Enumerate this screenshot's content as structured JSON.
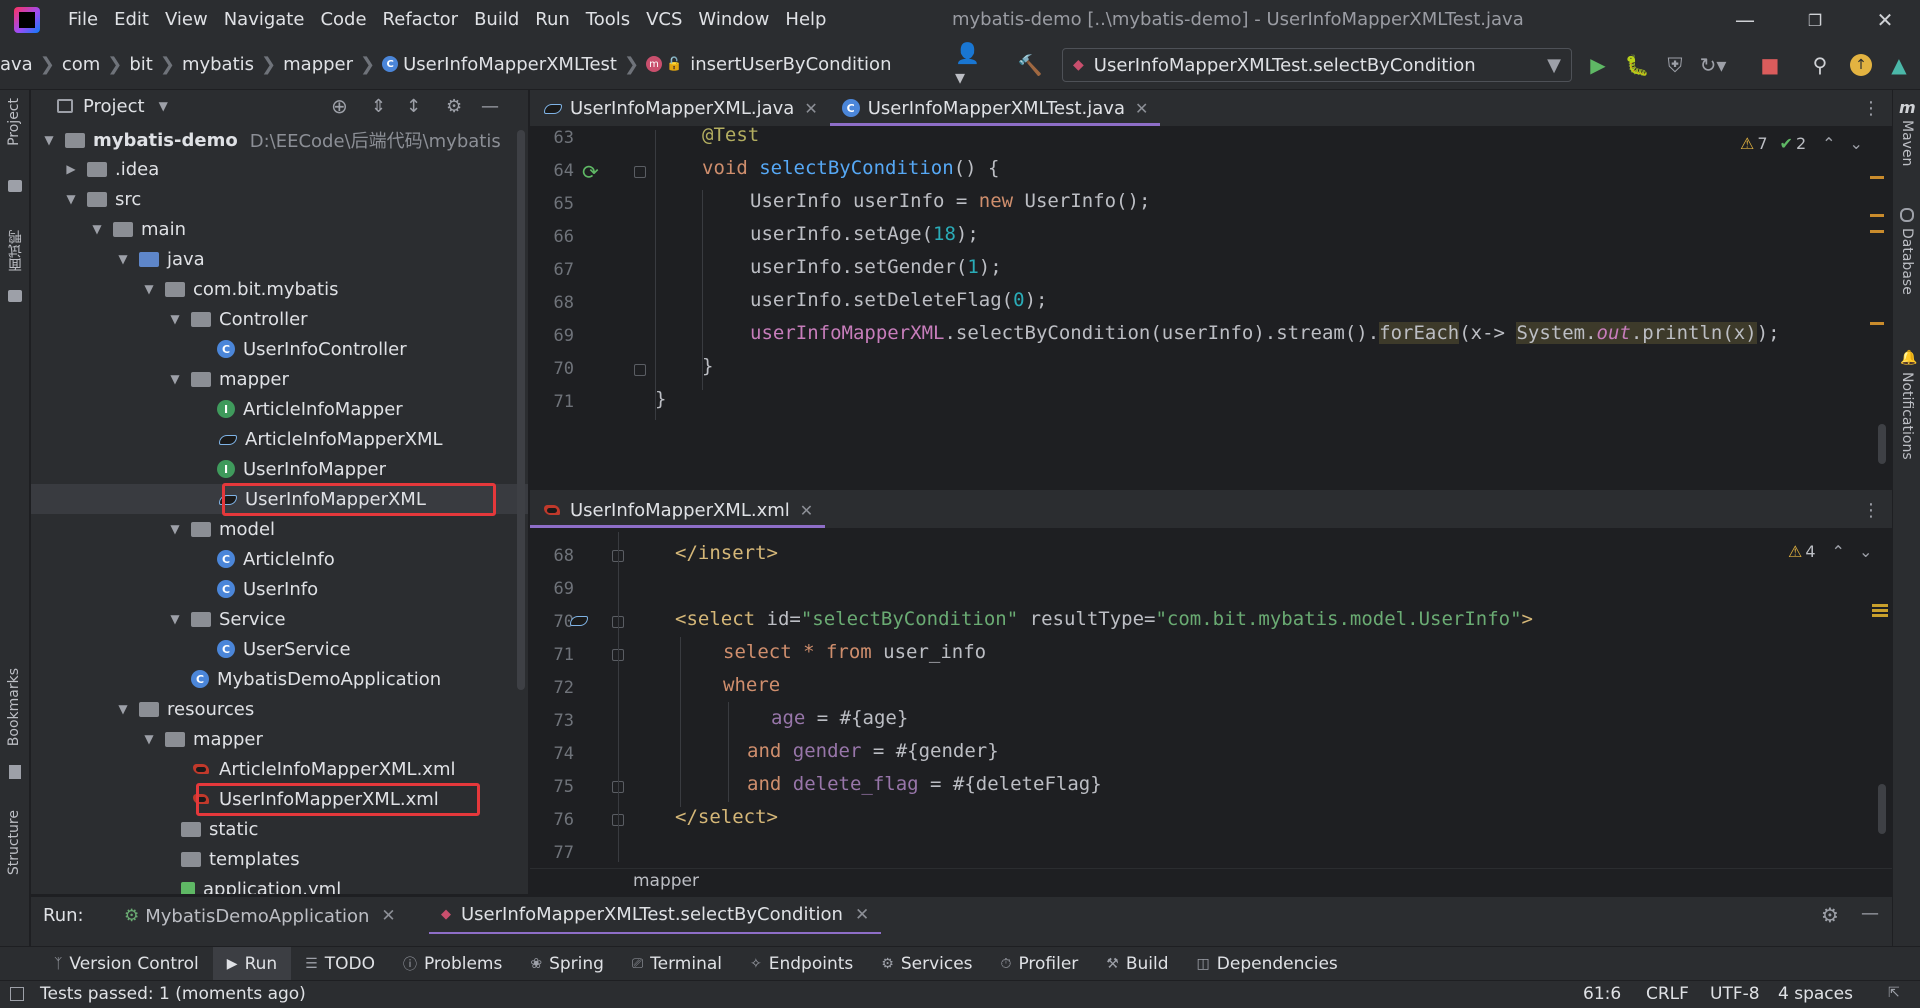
{
  "window": {
    "menus": [
      "File",
      "Edit",
      "View",
      "Navigate",
      "Code",
      "Refactor",
      "Build",
      "Run",
      "Tools",
      "VCS",
      "Window",
      "Help"
    ],
    "title": "mybatis-demo [..\\mybatis-demo] - UserInfoMapperXMLTest.java"
  },
  "breadcrumbs": [
    "ava",
    "com",
    "bit",
    "mybatis",
    "mapper",
    "UserInfoMapperXMLTest",
    "insertUserByCondition"
  ],
  "run_config": "UserInfoMapperXMLTest.selectByCondition",
  "left_stripe": {
    "project": "Project",
    "mianshi": "面试鸭",
    "bookmarks": "Bookmarks",
    "structure": "Structure"
  },
  "right_stripe": {
    "maven": "Maven",
    "database": "Database",
    "notifications": "Notifications"
  },
  "project_panel": {
    "title": "Project",
    "tree": [
      {
        "label": "mybatis-demo",
        "extra": "D:\\EECode\\后端代码\\mybatis",
        "kind": "module"
      },
      {
        "label": ".idea",
        "kind": "folder"
      },
      {
        "label": "src",
        "kind": "folder"
      },
      {
        "label": "main",
        "kind": "folder"
      },
      {
        "label": "java",
        "kind": "folder-blue"
      },
      {
        "label": "com.bit.mybatis",
        "kind": "package"
      },
      {
        "label": "Controller",
        "kind": "package"
      },
      {
        "label": "UserInfoController",
        "kind": "class"
      },
      {
        "label": "mapper",
        "kind": "package"
      },
      {
        "label": "ArticleInfoMapper",
        "kind": "interface"
      },
      {
        "label": "ArticleInfoMapperXML",
        "kind": "mybatis"
      },
      {
        "label": "UserInfoMapper",
        "kind": "interface"
      },
      {
        "label": "UserInfoMapperXML",
        "kind": "mybatis"
      },
      {
        "label": "model",
        "kind": "package"
      },
      {
        "label": "ArticleInfo",
        "kind": "class"
      },
      {
        "label": "UserInfo",
        "kind": "class"
      },
      {
        "label": "Service",
        "kind": "package"
      },
      {
        "label": "UserService",
        "kind": "class"
      },
      {
        "label": "MybatisDemoApplication",
        "kind": "springclass"
      },
      {
        "label": "resources",
        "kind": "folder-res"
      },
      {
        "label": "mapper",
        "kind": "folder"
      },
      {
        "label": "ArticleInfoMapperXML.xml",
        "kind": "xml"
      },
      {
        "label": "UserInfoMapperXML.xml",
        "kind": "xml"
      },
      {
        "label": "static",
        "kind": "folder"
      },
      {
        "label": "templates",
        "kind": "folder"
      },
      {
        "label": "application.yml",
        "kind": "yml"
      }
    ]
  },
  "editor_top": {
    "tabs": [
      {
        "label": "UserInfoMapperXML.java",
        "active": false
      },
      {
        "label": "UserInfoMapperXMLTest.java",
        "active": true
      }
    ],
    "warnings": "7",
    "checks": "2",
    "line_numbers": [
      "63",
      "64",
      "65",
      "66",
      "67",
      "68",
      "69",
      "70",
      "71"
    ],
    "code": {
      "l63": "@Test",
      "l64_kw": "void",
      "l64_fn": "selectByCondition",
      "l64_rest": "() {",
      "l65_a": "UserInfo userInfo = ",
      "l65_kw": "new",
      "l65_b": " UserInfo();",
      "l66_a": "userInfo.setAge(",
      "l66_n": "18",
      "l66_b": ");",
      "l67_a": "userInfo.setGender(",
      "l67_n": "1",
      "l67_b": ");",
      "l68_a": "userInfo.setDeleteFlag(",
      "l68_n": "0",
      "l68_b": ");",
      "l69_fld": "userInfoMapperXML",
      "l69_a": ".selectByCondition(userInfo).stream().",
      "l69_fe": "forEach",
      "l69_b": "(x-> ",
      "l69_sys": "System.",
      "l69_out": "out",
      "l69_c": ".println(x)",
      "l69_d": ");",
      "l70": "}",
      "l71": "}"
    }
  },
  "editor_bottom": {
    "tabs": [
      {
        "label": "UserInfoMapperXML.xml",
        "active": true
      }
    ],
    "warnings": "4",
    "line_numbers": [
      "68",
      "69",
      "70",
      "71",
      "72",
      "73",
      "74",
      "75",
      "76",
      "77"
    ],
    "code": {
      "l68": "</insert>",
      "l70_open": "<select",
      "l70_id_attr": " id=",
      "l70_id_val": "\"selectByCondition\"",
      "l70_rt_attr": " resultType=",
      "l70_rt_val": "\"com.bit.mybatis.model.UserInfo\"",
      "l70_close": ">",
      "l71_kw1": "select",
      "l71_star": " * ",
      "l71_kw2": "from",
      "l71_tbl": " user_info",
      "l72": "where",
      "l73_col": "age",
      "l73_rest": " = #{age}",
      "l74_kw": "and",
      "l74_col": " gender",
      "l74_rest": " = #{gender}",
      "l75_kw": "and",
      "l75_col": " delete_flag",
      "l75_rest": " = #{deleteFlag}",
      "l76": "</select>"
    },
    "breadcrumb": "mapper"
  },
  "run_bar": {
    "label": "Run:",
    "tabs": [
      {
        "label": "MybatisDemoApplication",
        "active": false
      },
      {
        "label": "UserInfoMapperXMLTest.selectByCondition",
        "active": true
      }
    ]
  },
  "bottom_tools": [
    "Version Control",
    "Run",
    "TODO",
    "Problems",
    "Spring",
    "Terminal",
    "Endpoints",
    "Services",
    "Profiler",
    "Build",
    "Dependencies"
  ],
  "status": {
    "message": "Tests passed: 1 (moments ago)",
    "position": "61:6",
    "line_sep": "CRLF",
    "encoding": "UTF-8",
    "indent": "4 spaces"
  },
  "colors": {
    "accent": "#8e6ec8",
    "highlight_box": "#e5383b",
    "bg": "#1e1f22",
    "panel": "#2b2d30"
  }
}
